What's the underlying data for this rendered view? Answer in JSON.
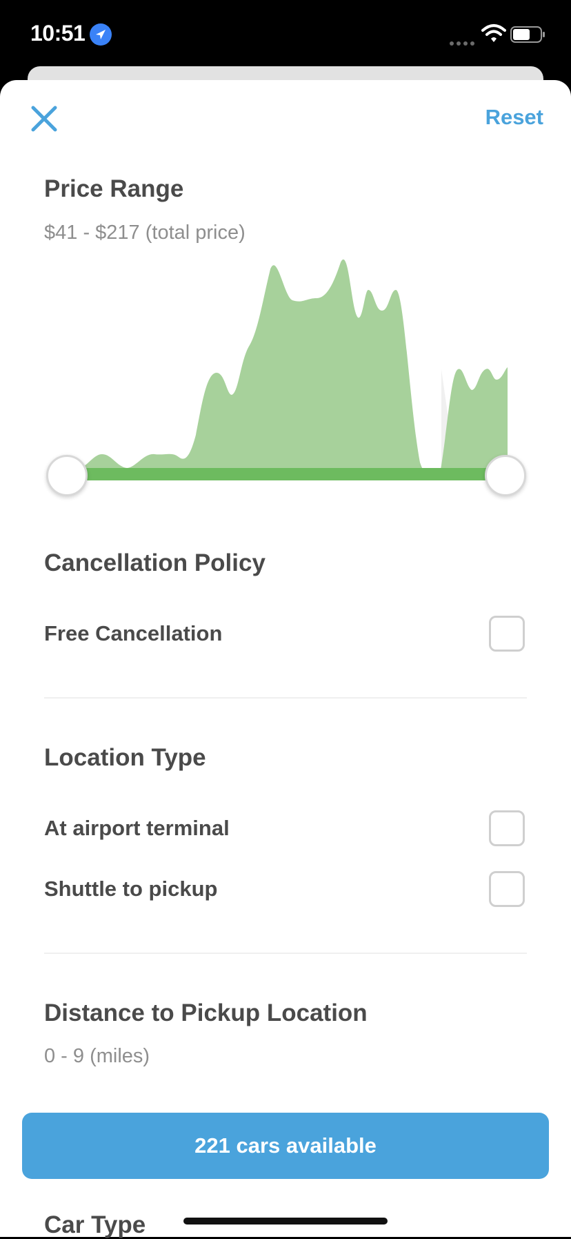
{
  "status_bar": {
    "time": "10:51"
  },
  "header": {
    "reset_label": "Reset"
  },
  "price_range": {
    "title": "Price Range",
    "range_text": "$41 - $217 (total price)",
    "min_value": 41,
    "max_value": 217,
    "accent_color": "#6dbb5f"
  },
  "cancellation": {
    "title": "Cancellation Policy",
    "options": [
      {
        "label": "Free Cancellation",
        "checked": false
      }
    ]
  },
  "location_type": {
    "title": "Location Type",
    "options": [
      {
        "label": "At airport terminal",
        "checked": false
      },
      {
        "label": "Shuttle to pickup",
        "checked": false
      }
    ]
  },
  "distance": {
    "title": "Distance to Pickup Location",
    "range_text": "0 - 9 (miles)"
  },
  "cta": {
    "label": "221 cars available",
    "color": "#4aa3dc"
  },
  "car_type": {
    "title": "Car Type"
  }
}
